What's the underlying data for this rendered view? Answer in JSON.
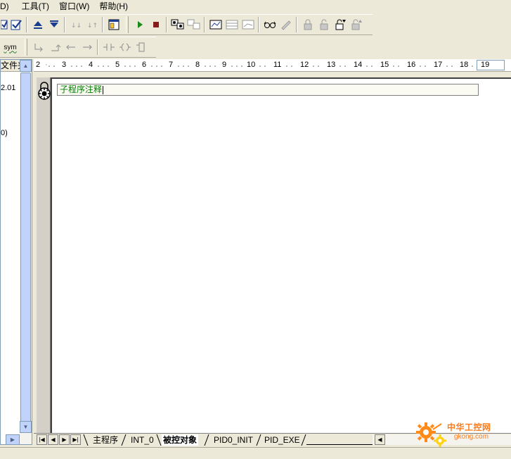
{
  "menu": {
    "items": [
      "D)",
      "工具(T)",
      "窗口(W)",
      "帮助(H)"
    ]
  },
  "toolbar2": {
    "sym_label": "sym"
  },
  "left_panel": {
    "header": "文件夹",
    "rows": [
      "2.01",
      "0)"
    ]
  },
  "ruler": {
    "labels": [
      "2",
      "3",
      "4",
      "5",
      "6",
      "7",
      "8",
      "9",
      "10",
      "11",
      "12",
      "13",
      "14",
      "15",
      "16",
      "17",
      "18"
    ],
    "boxed_label": "19"
  },
  "editor": {
    "comment": "子程序注释"
  },
  "tabs": {
    "items": [
      "主程序",
      "INT_0",
      "被控对象",
      "PID0_INIT",
      "PID_EXE"
    ],
    "active": "被控对象"
  },
  "watermark": {
    "line1": "中华工控网",
    "line2": "gkong.com"
  },
  "colors": {
    "chrome": "#ece9d8",
    "comment_text": "#008000",
    "scroll_blue": "#c1d3fb",
    "watermark": "#ff7a1a"
  }
}
